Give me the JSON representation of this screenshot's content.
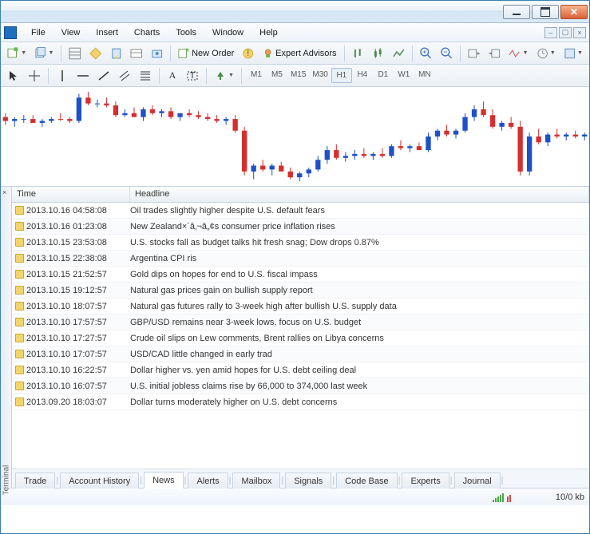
{
  "menu": {
    "file": "File",
    "view": "View",
    "insert": "Insert",
    "charts": "Charts",
    "tools": "Tools",
    "window": "Window",
    "help": "Help"
  },
  "toolbar1": {
    "new_order": "New Order",
    "expert_advisors": "Expert Advisors"
  },
  "timeframes": [
    "M1",
    "M5",
    "M15",
    "M30",
    "H1",
    "H4",
    "D1",
    "W1",
    "MN"
  ],
  "active_timeframe": "H1",
  "panel": {
    "label": "Terminal",
    "col_time": "Time",
    "col_headline": "Headline"
  },
  "news": [
    {
      "time": "2013.10.16 04:58:08",
      "headline": "Oil trades slightly higher despite U.S. default fears"
    },
    {
      "time": "2013.10.16 01:23:08",
      "headline": "New Zealand×´â‚¬â„¢s consumer price inflation rises"
    },
    {
      "time": "2013.10.15 23:53:08",
      "headline": "U.S. stocks fall as budget talks hit fresh snag; Dow drops 0.87%"
    },
    {
      "time": "2013.10.15 22:38:08",
      "headline": "Argentina CPI ris"
    },
    {
      "time": "2013.10.15 21:52:57",
      "headline": "Gold dips on hopes for end to U.S. fiscal impass"
    },
    {
      "time": "2013.10.15 19:12:57",
      "headline": "Natural gas prices gain on bullish supply report"
    },
    {
      "time": "2013.10.10 18:07:57",
      "headline": "Natural gas futures rally to 3-week high after bullish U.S. supply data"
    },
    {
      "time": "2013.10.10 17:57:57",
      "headline": "GBP/USD remains near 3-week lows, focus on U.S. budget"
    },
    {
      "time": "2013.10.10 17:27:57",
      "headline": "Crude oil slips on Lew comments, Brent rallies on Libya concerns"
    },
    {
      "time": "2013.10.10 17:07:57",
      "headline": "USD/CAD little changed in early trad"
    },
    {
      "time": "2013.10.10 16:22:57",
      "headline": "Dollar higher vs. yen amid hopes for U.S. debt ceiling deal"
    },
    {
      "time": "2013.10.10 16:07:57",
      "headline": "U.S. initial jobless claims rise by 66,000 to 374,000 last week"
    },
    {
      "time": "2013.09.20 18:03:07",
      "headline": "Dollar turns moderately higher on U.S. debt concerns"
    }
  ],
  "tabs": [
    "Trade",
    "Account History",
    "News",
    "Alerts",
    "Mailbox",
    "Signals",
    "Code Base",
    "Experts",
    "Journal"
  ],
  "active_tab": "News",
  "status": {
    "conn": "10/0 kb"
  },
  "chart_data": {
    "type": "candlestick",
    "note": "values are approximate pixel-read OHLC; red=bearish, blue=bullish",
    "series": [
      {
        "o": 50,
        "h": 52,
        "l": 46,
        "c": 48,
        "dir": "down"
      },
      {
        "o": 48,
        "h": 50,
        "l": 45,
        "c": 49,
        "dir": "up"
      },
      {
        "o": 49,
        "h": 51,
        "l": 47,
        "c": 49,
        "dir": "up"
      },
      {
        "o": 49,
        "h": 51,
        "l": 47,
        "c": 47,
        "dir": "down"
      },
      {
        "o": 47,
        "h": 49,
        "l": 45,
        "c": 48,
        "dir": "up"
      },
      {
        "o": 48,
        "h": 50,
        "l": 47,
        "c": 49,
        "dir": "up"
      },
      {
        "o": 49,
        "h": 52,
        "l": 48,
        "c": 49,
        "dir": "down"
      },
      {
        "o": 49,
        "h": 50,
        "l": 47,
        "c": 48,
        "dir": "down"
      },
      {
        "o": 48,
        "h": 62,
        "l": 47,
        "c": 60,
        "dir": "up"
      },
      {
        "o": 60,
        "h": 63,
        "l": 56,
        "c": 57,
        "dir": "down"
      },
      {
        "o": 57,
        "h": 59,
        "l": 55,
        "c": 57,
        "dir": "up"
      },
      {
        "o": 57,
        "h": 60,
        "l": 55,
        "c": 56,
        "dir": "down"
      },
      {
        "o": 56,
        "h": 58,
        "l": 50,
        "c": 51,
        "dir": "down"
      },
      {
        "o": 51,
        "h": 54,
        "l": 50,
        "c": 52,
        "dir": "up"
      },
      {
        "o": 52,
        "h": 55,
        "l": 50,
        "c": 50,
        "dir": "down"
      },
      {
        "o": 50,
        "h": 55,
        "l": 48,
        "c": 54,
        "dir": "up"
      },
      {
        "o": 54,
        "h": 56,
        "l": 51,
        "c": 52,
        "dir": "down"
      },
      {
        "o": 52,
        "h": 54,
        "l": 50,
        "c": 53,
        "dir": "up"
      },
      {
        "o": 53,
        "h": 55,
        "l": 49,
        "c": 50,
        "dir": "down"
      },
      {
        "o": 50,
        "h": 52,
        "l": 48,
        "c": 52,
        "dir": "up"
      },
      {
        "o": 52,
        "h": 54,
        "l": 50,
        "c": 51,
        "dir": "down"
      },
      {
        "o": 51,
        "h": 53,
        "l": 49,
        "c": 50,
        "dir": "down"
      },
      {
        "o": 50,
        "h": 52,
        "l": 48,
        "c": 49,
        "dir": "down"
      },
      {
        "o": 49,
        "h": 51,
        "l": 47,
        "c": 48,
        "dir": "down"
      },
      {
        "o": 48,
        "h": 50,
        "l": 46,
        "c": 49,
        "dir": "up"
      },
      {
        "o": 49,
        "h": 51,
        "l": 42,
        "c": 43,
        "dir": "down"
      },
      {
        "o": 43,
        "h": 45,
        "l": 20,
        "c": 22,
        "dir": "down"
      },
      {
        "o": 22,
        "h": 26,
        "l": 18,
        "c": 25,
        "dir": "up"
      },
      {
        "o": 25,
        "h": 28,
        "l": 22,
        "c": 23,
        "dir": "down"
      },
      {
        "o": 23,
        "h": 26,
        "l": 20,
        "c": 25,
        "dir": "up"
      },
      {
        "o": 25,
        "h": 27,
        "l": 22,
        "c": 22,
        "dir": "down"
      },
      {
        "o": 22,
        "h": 24,
        "l": 18,
        "c": 19,
        "dir": "down"
      },
      {
        "o": 19,
        "h": 22,
        "l": 17,
        "c": 21,
        "dir": "up"
      },
      {
        "o": 21,
        "h": 24,
        "l": 19,
        "c": 23,
        "dir": "up"
      },
      {
        "o": 23,
        "h": 30,
        "l": 22,
        "c": 28,
        "dir": "up"
      },
      {
        "o": 28,
        "h": 35,
        "l": 26,
        "c": 33,
        "dir": "up"
      },
      {
        "o": 33,
        "h": 36,
        "l": 28,
        "c": 29,
        "dir": "down"
      },
      {
        "o": 29,
        "h": 32,
        "l": 27,
        "c": 30,
        "dir": "up"
      },
      {
        "o": 30,
        "h": 33,
        "l": 28,
        "c": 31,
        "dir": "up"
      },
      {
        "o": 31,
        "h": 34,
        "l": 29,
        "c": 30,
        "dir": "down"
      },
      {
        "o": 30,
        "h": 32,
        "l": 28,
        "c": 31,
        "dir": "up"
      },
      {
        "o": 31,
        "h": 34,
        "l": 29,
        "c": 30,
        "dir": "down"
      },
      {
        "o": 30,
        "h": 36,
        "l": 29,
        "c": 35,
        "dir": "up"
      },
      {
        "o": 35,
        "h": 38,
        "l": 33,
        "c": 34,
        "dir": "down"
      },
      {
        "o": 34,
        "h": 36,
        "l": 32,
        "c": 35,
        "dir": "up"
      },
      {
        "o": 35,
        "h": 37,
        "l": 33,
        "c": 33,
        "dir": "down"
      },
      {
        "o": 33,
        "h": 42,
        "l": 32,
        "c": 40,
        "dir": "up"
      },
      {
        "o": 40,
        "h": 44,
        "l": 38,
        "c": 43,
        "dir": "up"
      },
      {
        "o": 43,
        "h": 46,
        "l": 40,
        "c": 41,
        "dir": "down"
      },
      {
        "o": 41,
        "h": 44,
        "l": 39,
        "c": 43,
        "dir": "up"
      },
      {
        "o": 43,
        "h": 52,
        "l": 42,
        "c": 50,
        "dir": "up"
      },
      {
        "o": 50,
        "h": 56,
        "l": 48,
        "c": 54,
        "dir": "up"
      },
      {
        "o": 54,
        "h": 58,
        "l": 50,
        "c": 51,
        "dir": "down"
      },
      {
        "o": 51,
        "h": 54,
        "l": 44,
        "c": 45,
        "dir": "down"
      },
      {
        "o": 45,
        "h": 48,
        "l": 43,
        "c": 47,
        "dir": "up"
      },
      {
        "o": 47,
        "h": 50,
        "l": 44,
        "c": 45,
        "dir": "down"
      },
      {
        "o": 45,
        "h": 48,
        "l": 20,
        "c": 22,
        "dir": "down"
      },
      {
        "o": 22,
        "h": 42,
        "l": 20,
        "c": 40,
        "dir": "up"
      },
      {
        "o": 40,
        "h": 44,
        "l": 36,
        "c": 37,
        "dir": "down"
      },
      {
        "o": 37,
        "h": 42,
        "l": 35,
        "c": 41,
        "dir": "up"
      },
      {
        "o": 41,
        "h": 44,
        "l": 39,
        "c": 40,
        "dir": "down"
      },
      {
        "o": 40,
        "h": 42,
        "l": 38,
        "c": 41,
        "dir": "up"
      },
      {
        "o": 41,
        "h": 43,
        "l": 39,
        "c": 40,
        "dir": "down"
      },
      {
        "o": 40,
        "h": 42,
        "l": 38,
        "c": 41,
        "dir": "up"
      }
    ]
  }
}
